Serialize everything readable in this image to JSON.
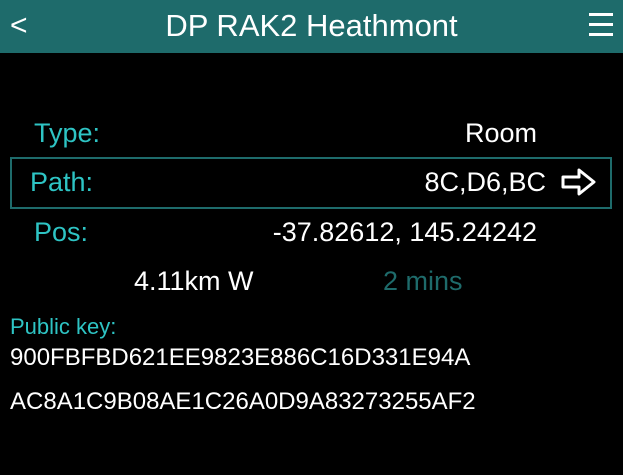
{
  "header": {
    "back_label": "<",
    "title": "DP RAK2 Heathmont",
    "menu_icon": "hamburger-menu-icon"
  },
  "details": {
    "type_label": "Type:",
    "type_value": "Room",
    "path_label": "Path:",
    "path_value": "8C,D6,BC",
    "path_arrow_icon": "arrow-right-outline-icon",
    "pos_label": "Pos:",
    "pos_value": "-37.82612, 145.24242",
    "distance": "4.11km W",
    "age": "2 mins"
  },
  "public_key": {
    "label": "Public key:",
    "line1": "900FBFBD621EE9823E886C16D331E94A",
    "line2": "AC8A1C9B08AE1C26A0D9A83273255AF2"
  },
  "colors": {
    "header_bg": "#1e6b6b",
    "label": "#2ec4c4",
    "muted": "#1e6b6b",
    "background": "#000000"
  }
}
